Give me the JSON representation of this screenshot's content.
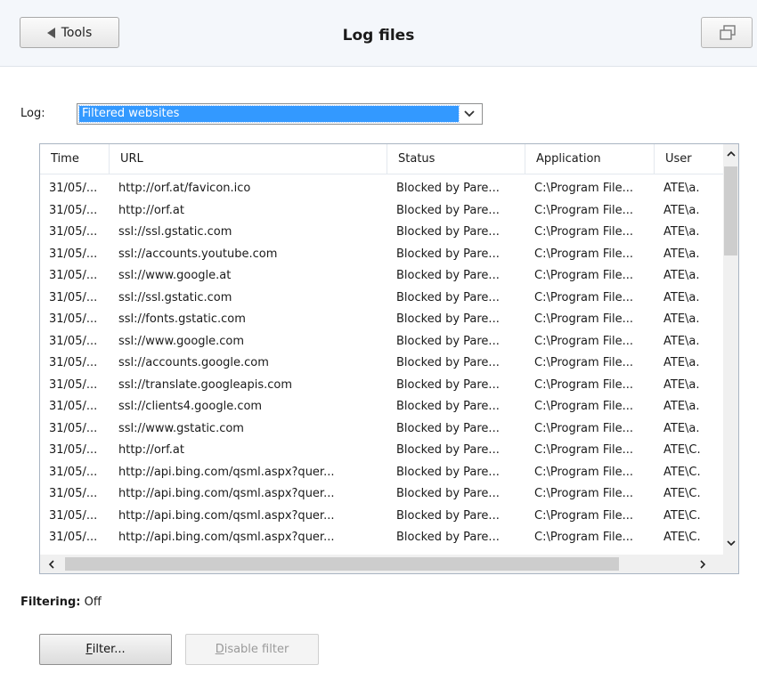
{
  "header": {
    "back_label": "Tools",
    "title": "Log files",
    "icons": {
      "back": "triangle-left-icon",
      "restore": "restore-window-icon"
    }
  },
  "log_selector": {
    "label": "Log:",
    "selected": "Filtered websites"
  },
  "table": {
    "columns": [
      "Time",
      "URL",
      "Status",
      "Application",
      "User"
    ],
    "rows": [
      [
        "31/05/...",
        "http://orf.at/favicon.ico",
        "Blocked by Pare...",
        "C:\\Program File...",
        "ATE\\a."
      ],
      [
        "31/05/...",
        "http://orf.at",
        "Blocked by Pare...",
        "C:\\Program File...",
        "ATE\\a."
      ],
      [
        "31/05/...",
        "ssl://ssl.gstatic.com",
        "Blocked by Pare...",
        "C:\\Program File...",
        "ATE\\a."
      ],
      [
        "31/05/...",
        "ssl://accounts.youtube.com",
        "Blocked by Pare...",
        "C:\\Program File...",
        "ATE\\a."
      ],
      [
        "31/05/...",
        "ssl://www.google.at",
        "Blocked by Pare...",
        "C:\\Program File...",
        "ATE\\a."
      ],
      [
        "31/05/...",
        "ssl://ssl.gstatic.com",
        "Blocked by Pare...",
        "C:\\Program File...",
        "ATE\\a."
      ],
      [
        "31/05/...",
        "ssl://fonts.gstatic.com",
        "Blocked by Pare...",
        "C:\\Program File...",
        "ATE\\a."
      ],
      [
        "31/05/...",
        "ssl://www.google.com",
        "Blocked by Pare...",
        "C:\\Program File...",
        "ATE\\a."
      ],
      [
        "31/05/...",
        "ssl://accounts.google.com",
        "Blocked by Pare...",
        "C:\\Program File...",
        "ATE\\a."
      ],
      [
        "31/05/...",
        "ssl://translate.googleapis.com",
        "Blocked by Pare...",
        "C:\\Program File...",
        "ATE\\a."
      ],
      [
        "31/05/...",
        "ssl://clients4.google.com",
        "Blocked by Pare...",
        "C:\\Program File...",
        "ATE\\a."
      ],
      [
        "31/05/...",
        "ssl://www.gstatic.com",
        "Blocked by Pare...",
        "C:\\Program File...",
        "ATE\\a."
      ],
      [
        "31/05/...",
        "http://orf.at",
        "Blocked by Pare...",
        "C:\\Program File...",
        "ATE\\C."
      ],
      [
        "31/05/...",
        "http://api.bing.com/qsml.aspx?quer...",
        "Blocked by Pare...",
        "C:\\Program File...",
        "ATE\\C."
      ],
      [
        "31/05/...",
        "http://api.bing.com/qsml.aspx?quer...",
        "Blocked by Pare...",
        "C:\\Program File...",
        "ATE\\C."
      ],
      [
        "31/05/...",
        "http://api.bing.com/qsml.aspx?quer...",
        "Blocked by Pare...",
        "C:\\Program File...",
        "ATE\\C."
      ],
      [
        "31/05/...",
        "http://api.bing.com/qsml.aspx?quer...",
        "Blocked by Pare...",
        "C:\\Program File...",
        "ATE\\C."
      ]
    ]
  },
  "filtering": {
    "label": "Filtering:",
    "value": "Off"
  },
  "buttons": {
    "filter_mnemonic": "F",
    "filter_rest": "ilter...",
    "disable_mnemonic": "D",
    "disable_rest": "isable filter"
  },
  "colors": {
    "selection": "#3399ff",
    "header_bg": "#f4f7fb",
    "disabled_text": "#9a9a9a"
  }
}
